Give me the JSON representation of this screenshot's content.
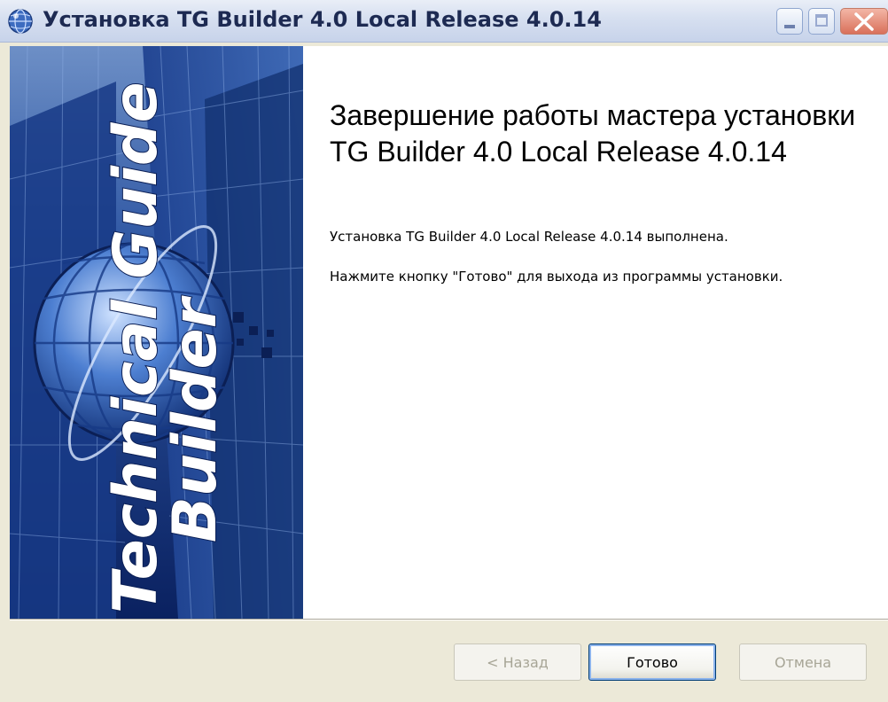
{
  "window": {
    "title": "Установка TG Builder 4.0 Local Release 4.0.14",
    "icon": "installer-globe-icon",
    "controls": [
      "minimize-icon",
      "maximize-icon",
      "close-icon"
    ]
  },
  "banner": {
    "line1": "Technical Guide",
    "line2": "Builder"
  },
  "main": {
    "heading": "Завершение работы мастера установки TG Builder 4.0 Local Release 4.0.14",
    "status_text": "Установка TG Builder 4.0 Local Release 4.0.14 выполнена.",
    "instruction_text": "Нажмите кнопку \"Готово\" для выхода из программы установки."
  },
  "buttons": {
    "back_label": "< Назад",
    "finish_label": "Готово",
    "cancel_label": "Отмена"
  },
  "colors": {
    "accent": "#003c74",
    "banner_blue": "#0c2a78",
    "close_red": "#d9705a"
  }
}
